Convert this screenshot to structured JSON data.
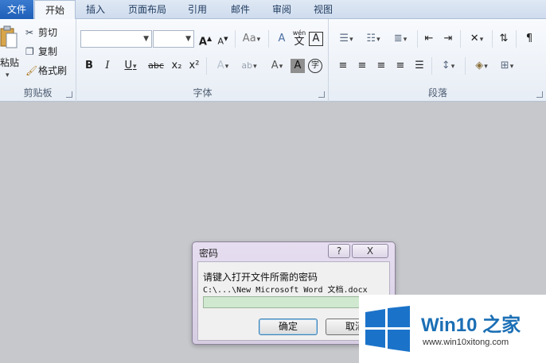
{
  "tabs": [
    "文件",
    "开始",
    "插入",
    "页面布局",
    "引用",
    "邮件",
    "审阅",
    "视图"
  ],
  "clipboard": {
    "paste_label": "粘贴",
    "cut_label": "剪切",
    "copy_label": "复制",
    "format_painter_label": "格式刷",
    "group_label": "剪贴板"
  },
  "font": {
    "font_name": "",
    "font_size": "",
    "grow_label": "A",
    "shrink_label": "A",
    "case_label": "Aa",
    "clear_label": "A",
    "phonetic_label": "wén",
    "phonetic_char": "文",
    "border_char_label": "A",
    "bold_label": "B",
    "italic_label": "I",
    "underline_label": "U",
    "strike_label": "abc",
    "subscript_label": "x₂",
    "superscript_label": "x²",
    "effects_label": "A",
    "highlight_label": "ab",
    "color_label": "A",
    "shading_label": "A",
    "enclose_label": "字",
    "group_label": "字体"
  },
  "paragraph": {
    "group_label": "段落"
  },
  "dialog": {
    "title": "密码",
    "help_label": "?",
    "close_label": "X",
    "prompt": "请键入打开文件所需的密码",
    "file_path": "C:\\...\\New Microsoft Word 文档.docx",
    "password_value": "",
    "ok_label": "确定",
    "cancel_label": "取消"
  },
  "watermark": {
    "brand": "Win10 之家",
    "url": "www.win10xitong.com",
    "logo_color": "#1b73c9"
  }
}
